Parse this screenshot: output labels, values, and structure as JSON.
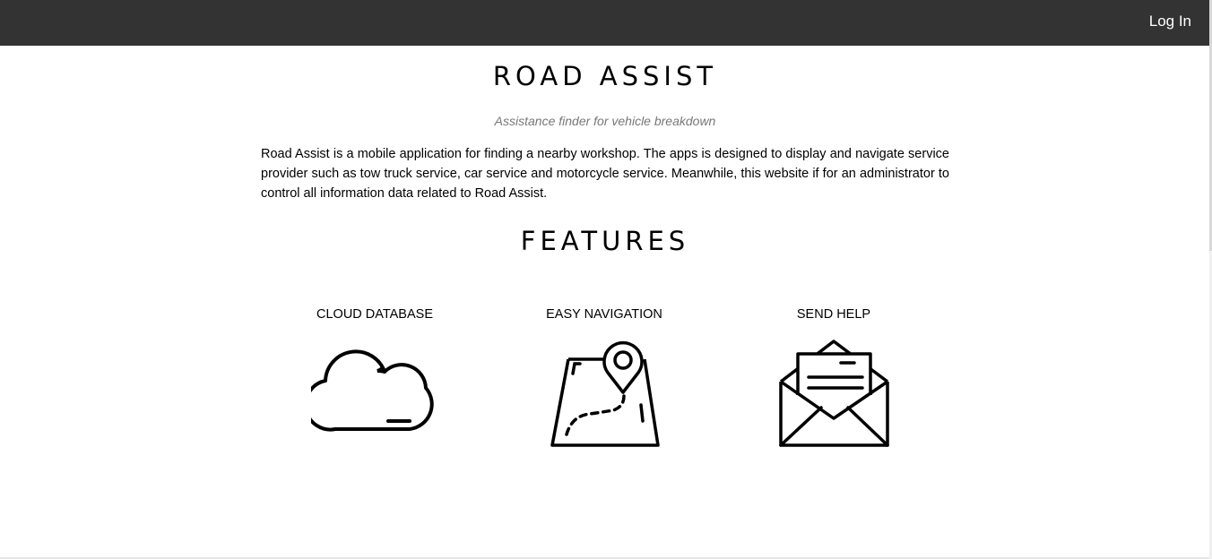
{
  "header": {
    "login_label": "Log In"
  },
  "hero": {
    "title": "ROAD ASSIST",
    "subtitle": "Assistance finder for vehicle breakdown",
    "description": "Road Assist is a mobile application for finding a nearby workshop. The apps is designed to display and navigate service provider such as tow truck service, car service and motorcycle service. Meanwhile, this website if for an administrator to control all information data related to Road Assist."
  },
  "features": {
    "heading": "FEATURES",
    "items": [
      {
        "label": "CLOUD DATABASE",
        "icon": "cloud-icon"
      },
      {
        "label": "EASY NAVIGATION",
        "icon": "map-pin-icon"
      },
      {
        "label": "SEND HELP",
        "icon": "envelope-icon"
      }
    ]
  },
  "colors": {
    "topbar": "#333333",
    "subtitle": "#777777",
    "text": "#000000"
  }
}
